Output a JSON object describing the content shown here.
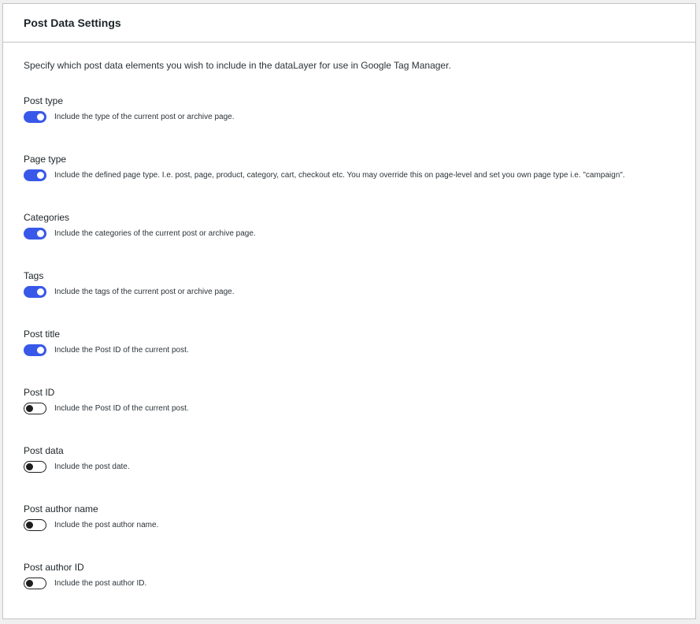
{
  "panel": {
    "title": "Post Data Settings",
    "intro": "Specify which post data elements you wish to include in the dataLayer for use in Google Tag Manager."
  },
  "settings": [
    {
      "label": "Post type",
      "description": "Include the type of the current post or archive page.",
      "enabled": true
    },
    {
      "label": "Page type",
      "description": "Include the defined page type. I.e. post, page, product, category, cart, checkout etc. You may override this on page-level and set you own page type i.e. \"campaign\".",
      "enabled": true
    },
    {
      "label": "Categories",
      "description": "Include the categories of the current post or archive page.",
      "enabled": true
    },
    {
      "label": "Tags",
      "description": "Include the tags of the current post or archive page.",
      "enabled": true
    },
    {
      "label": "Post title",
      "description": "Include the Post ID of the current post.",
      "enabled": true
    },
    {
      "label": "Post ID",
      "description": "Include the Post ID of the current post.",
      "enabled": false
    },
    {
      "label": "Post data",
      "description": "Include the post date.",
      "enabled": false
    },
    {
      "label": "Post author name",
      "description": "Include the post author name.",
      "enabled": false
    },
    {
      "label": "Post author ID",
      "description": "Include the post author ID.",
      "enabled": false
    }
  ],
  "colors": {
    "toggle_on": "#3858e9",
    "toggle_off_border": "#1e1e1e"
  }
}
